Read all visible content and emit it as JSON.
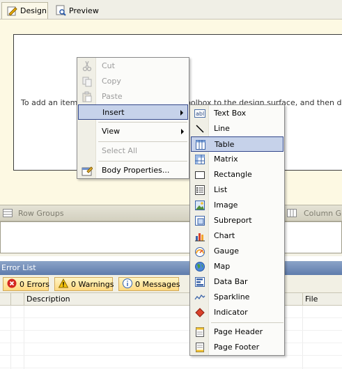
{
  "tabs": {
    "design": "Design",
    "preview": "Preview"
  },
  "surface": {
    "hint_left": "To add an item t",
    "hint_right": "e Toolbox to the design surface, and then dr"
  },
  "groups": {
    "row_groups": "Row Groups",
    "column_groups": "Column Gro"
  },
  "error_list": {
    "title": "Error List",
    "errors": "0 Errors",
    "warnings": "0 Warnings",
    "messages": "0 Messages",
    "col_description": "Description",
    "col_file": "File"
  },
  "context_menu": {
    "cut": "Cut",
    "copy": "Copy",
    "paste": "Paste",
    "insert": "Insert",
    "view": "View",
    "select_all": "Select All",
    "body_properties": "Body Properties..."
  },
  "insert_menu": {
    "items": [
      "Text Box",
      "Line",
      "Table",
      "Matrix",
      "Rectangle",
      "List",
      "Image",
      "Subreport",
      "Chart",
      "Gauge",
      "Map",
      "Data Bar",
      "Sparkline",
      "Indicator"
    ],
    "page_header": "Page Header",
    "page_footer": "Page Footer"
  },
  "colors": {
    "highlight": "#c6d2ea",
    "highlight_border": "#31468a",
    "surface": "#fdf9e3"
  }
}
